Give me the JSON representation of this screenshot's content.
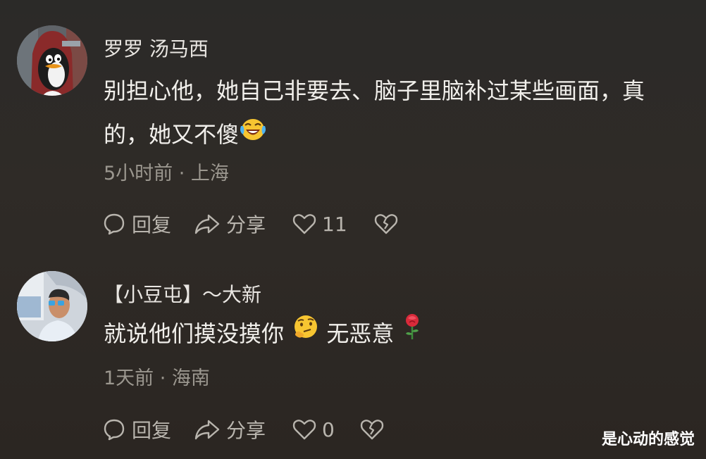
{
  "comments": [
    {
      "username": "罗罗 汤马西",
      "text": "别担心他，她自己非要去、脑子里脑补过某些画面，真的，她又不傻",
      "emoji": "laughing-crying-emoji",
      "meta": "5小时前 · 上海",
      "reply_label": "回复",
      "share_label": "分享",
      "like_count": "11"
    },
    {
      "username": "【小豆屯】～大新",
      "text_before": "就说他们摸没摸你",
      "emoji_1": "thinking-emoji",
      "text_after": "无恶意",
      "emoji_2": "rose-emoji",
      "meta": "1天前 · 海南",
      "reply_label": "回复",
      "share_label": "分享",
      "like_count": "0"
    }
  ],
  "watermark": "是心动的感觉",
  "colors": {
    "background": "#2d2925",
    "text_primary": "#f1efeb",
    "text_secondary": "#9b978f",
    "icon": "#b9b5ae"
  }
}
